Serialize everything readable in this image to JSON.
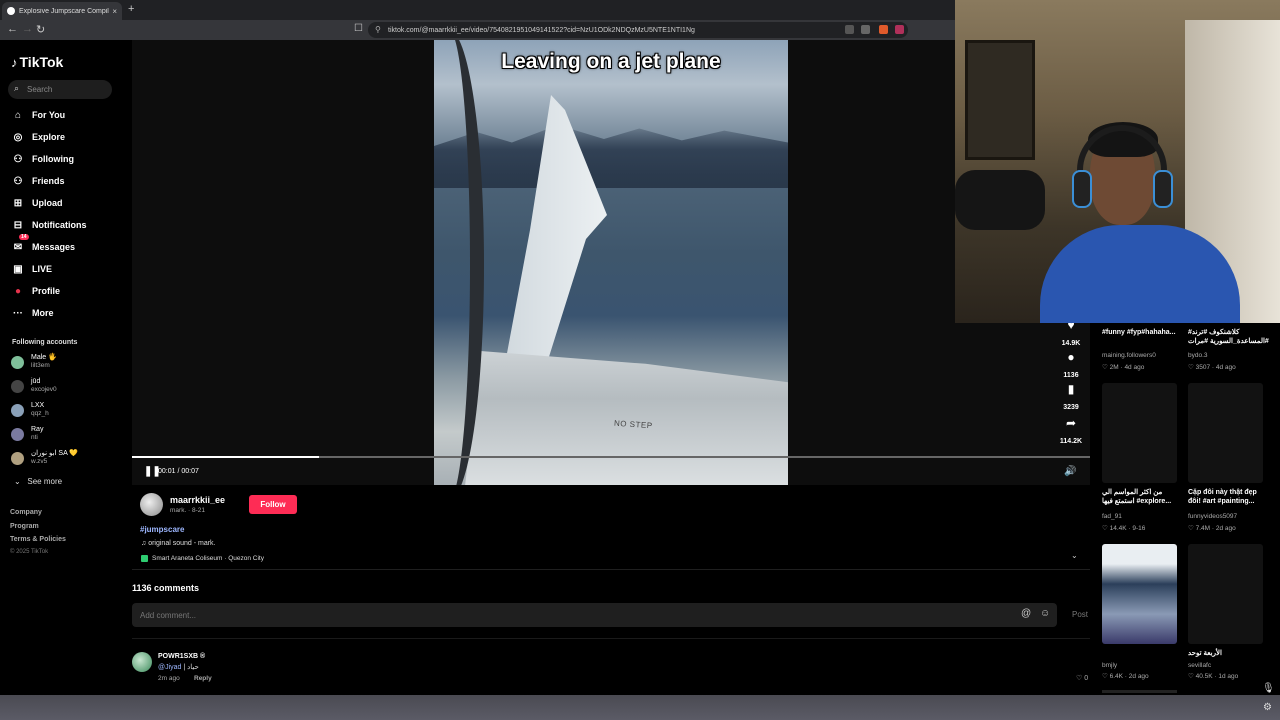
{
  "browser": {
    "tab_title": "Explosive Jumpscare Compil",
    "tab_close": "×",
    "new_tab": "+",
    "url": "tiktok.com/@maarrkkii_ee/video/7540821951049141522?cid=NzU1ODk2NDQzMzU5NTE1NTI1Ng",
    "back": "←",
    "forward": "→",
    "reload": "↻",
    "bookmark": "☐",
    "lock": "⚲"
  },
  "sidebar": {
    "logo": "TikTok",
    "search_placeholder": "Search",
    "nav": [
      {
        "label": "For You",
        "icon": "⌂"
      },
      {
        "label": "Explore",
        "icon": "◎"
      },
      {
        "label": "Following",
        "icon": "⚇"
      },
      {
        "label": "Friends",
        "icon": "⚇"
      },
      {
        "label": "Upload",
        "icon": "⊞"
      },
      {
        "label": "Notifications",
        "icon": "⊟"
      },
      {
        "label": "Messages",
        "icon": "✉",
        "badge": "14"
      },
      {
        "label": "LIVE",
        "icon": "▣"
      },
      {
        "label": "Profile",
        "icon": "●"
      },
      {
        "label": "More",
        "icon": "···"
      }
    ],
    "following_title": "Following accounts",
    "accounts": [
      {
        "name": "Male 🖐",
        "handle": "lilt3em",
        "color": "#7fbf9a"
      },
      {
        "name": "jūd",
        "handle": "excojev0",
        "color": "#444"
      },
      {
        "name": "LXX",
        "handle": "qqz_h",
        "color": "#8aa0b8"
      },
      {
        "name": "Ray",
        "handle": "nti",
        "color": "#7a7aa0"
      },
      {
        "name": "ابو نوران SA 💛",
        "handle": "w.zv5",
        "color": "#b0a080"
      }
    ],
    "see_more": "See more",
    "footer": [
      "Company",
      "Program",
      "Terms & Policies"
    ],
    "copyright": "© 2025 TikTok"
  },
  "video": {
    "caption": "Leaving on a jet plane",
    "progress": 0.195,
    "time": "00:01 / 00:07",
    "overlay_text": "NO STEP",
    "actions": [
      {
        "name": "like",
        "icon": "♥",
        "count": "14.9K"
      },
      {
        "name": "comment",
        "icon": "●",
        "count": "1136"
      },
      {
        "name": "save",
        "icon": "▮",
        "count": "3239"
      },
      {
        "name": "share",
        "icon": "➦",
        "count": "114.2K"
      }
    ]
  },
  "post": {
    "author": "maarrkkii_ee",
    "author_sub": "mark. · 8-21",
    "follow": "Follow",
    "hashtag": "#jumpscare",
    "sound": "♫ original sound - mark.",
    "location": "Smart Araneta Coliseum · Quezon City"
  },
  "comments": {
    "count_label": "1136 comments",
    "placeholder": "Add comment...",
    "post": "Post",
    "items": [
      {
        "user": "POWR1SXB ®",
        "mention": "@Jiyad",
        "text": " | حياد",
        "time": "2m ago",
        "reply": "Reply",
        "likes": "♡ 0"
      }
    ]
  },
  "recommendations": [
    {
      "title": "#funny #fyp#hahaha...",
      "user": "maining.followers0",
      "meta": "♡ 2M · 4d ago"
    },
    {
      "title": "#كلاشنكوف #ترند #المساعدة_السورية #مرات",
      "user": "bydo.3",
      "meta": "♡ 3507 · 4d ago"
    },
    {
      "title": "من اكثر المواسم الي استمتع فيها #explore...",
      "user": "fad_91",
      "meta": "♡ 14.4K · 9-16"
    },
    {
      "title": "Cặp đôi này thật đẹp đôi! #art #painting...",
      "user": "funnyvideos5097",
      "meta": "♡ 7.4M · 2d ago"
    },
    {
      "title": "",
      "user": "bmjly",
      "meta": "♡ 6.4K · 2d ago"
    },
    {
      "title": "الأربعة توحد",
      "user": "sevillafc",
      "meta": "♡ 40.5K · 1d ago"
    }
  ],
  "taskbar": {
    "mic": "🎙",
    "gear": "⚙"
  }
}
